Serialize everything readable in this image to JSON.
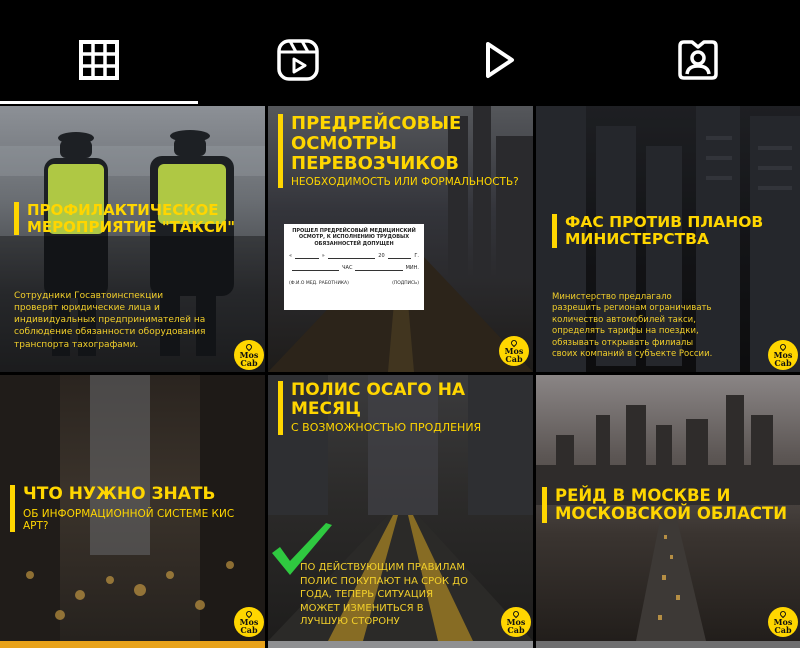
{
  "tabs": [
    {
      "name": "grid",
      "icon": "grid-icon",
      "active": true
    },
    {
      "name": "reels",
      "icon": "reels-icon",
      "active": false
    },
    {
      "name": "video",
      "icon": "play-icon",
      "active": false
    },
    {
      "name": "tagged",
      "icon": "tagged-icon",
      "active": false
    }
  ],
  "logo": {
    "line1": "Mos",
    "line2": "Cab"
  },
  "posts": [
    {
      "title": "ПРОФИЛАКТИЧЕСКОЕ МЕРОПРИЯТИЕ \"ТАКСИ\"",
      "body": "Сотрудники Госавтоинспекции проверят юридические лица и индивидуальных предпринимателей на соблюдение обязанности оборудования транспорта тахографами."
    },
    {
      "title": "ПРЕДРЕЙСОВЫЕ ОСМОТРЫ ПЕРЕВОЗЧИКОВ",
      "subtitle": "НЕОБХОДИМОСТЬ ИЛИ ФОРМАЛЬНОСТЬ?",
      "form": {
        "header": "ПРОШЕЛ ПРЕДРЕЙСОВЫЙ МЕДИЦИНСКИЙ ОСМОТР, К ИСПОЛНЕНИЮ ТРУДОВЫХ ОБЯЗАННОСТЕЙ ДОПУЩЕН",
        "date_prefix": "«",
        "date_suffix": "»",
        "year": "20",
        "year_suffix": "г.",
        "hours": "час",
        "minutes": "мин.",
        "sign_left": "(Ф.И.О мед. работника)",
        "sign_right": "(ПОДПИСЬ)"
      }
    },
    {
      "title": "ФАС ПРОТИВ ПЛАНОВ МИНИСТЕРСТВА",
      "body": "Министерство предлагало разрешить регионам ограничивать количество автомобилей такси, определять тарифы на поездки, обязывать открывать филиалы своих компаний в субъекте России."
    },
    {
      "title": "ЧТО НУЖНО ЗНАТЬ",
      "subtitle": "ОБ ИНФОРМАЦИОННОЙ СИСТЕМЕ КИС АРТ?"
    },
    {
      "title": "ПОЛИС ОСАГО НА МЕСЯЦ",
      "subtitle": "С ВОЗМОЖНОСТЬЮ ПРОДЛЕНИЯ",
      "body": "ПО ДЕЙСТВУЮЩИМ ПРАВИЛАМ ПОЛИС ПОКУПАЮТ НА СРОК ДО ГОДА, ТЕПЕРЬ СИТУАЦИЯ МОЖЕТ ИЗМЕНИТЬСЯ В ЛУЧШУЮ СТОРОНУ"
    },
    {
      "title": "РЕЙД В МОСКВЕ И МОСКОВСКОЙ ОБЛАСТИ"
    }
  ],
  "colors": {
    "accent": "#ffd600",
    "background": "#000000",
    "check": "#2fc940"
  }
}
